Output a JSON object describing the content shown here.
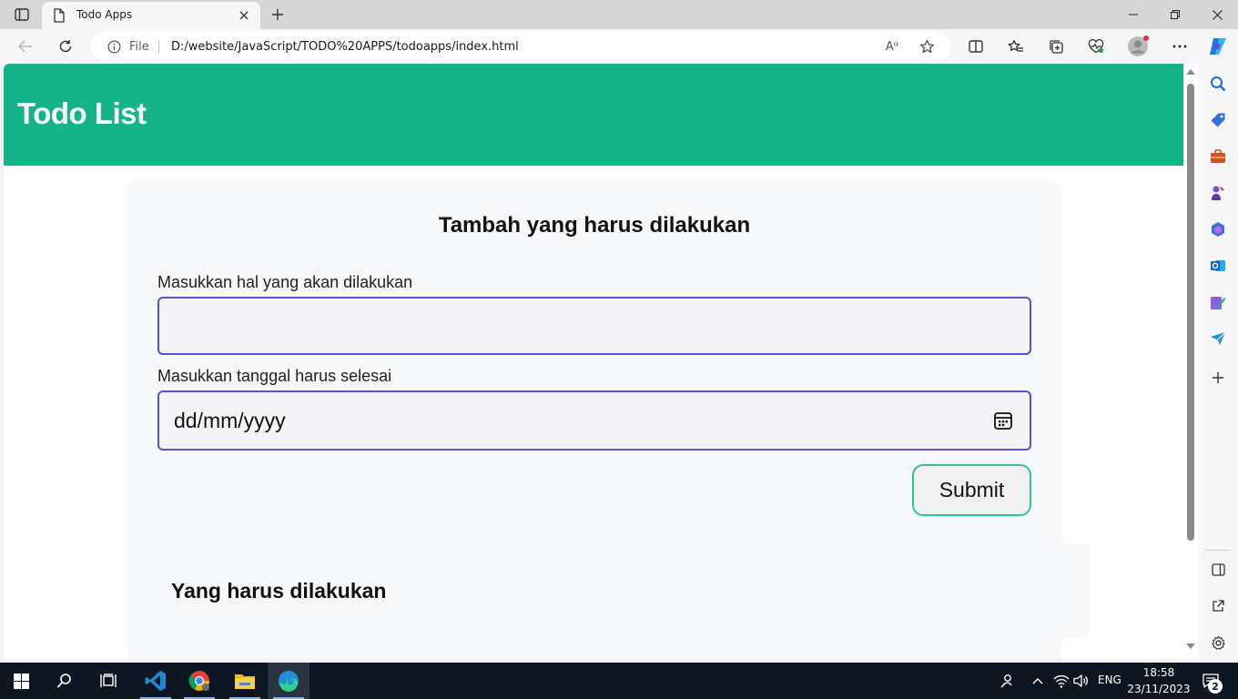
{
  "browser": {
    "tab_title": "Todo Apps",
    "file_label": "File",
    "url": "D:/website/JavaScript/TODO%20APPS/todoapps/index.html",
    "read_aloud_label": "Aᵅ"
  },
  "page": {
    "title": "Todo List",
    "form": {
      "heading": "Tambah yang harus dilakukan",
      "title_label": "Masukkan hal yang akan dilakukan",
      "title_value": "",
      "date_label": "Masukkan tanggal harus selesai",
      "date_placeholder": "dd/mm/yyyy",
      "submit_label": "Submit"
    },
    "todo_section": {
      "heading": "Yang harus dilakukan"
    }
  },
  "taskbar": {
    "lang": "ENG",
    "time": "18:58",
    "date": "23/11/2023",
    "notification_count": "2"
  },
  "colors": {
    "header": "#14b38a",
    "input_border": "#5b50d6",
    "submit_border": "#2ec59b",
    "taskbar": "#0f1722"
  }
}
